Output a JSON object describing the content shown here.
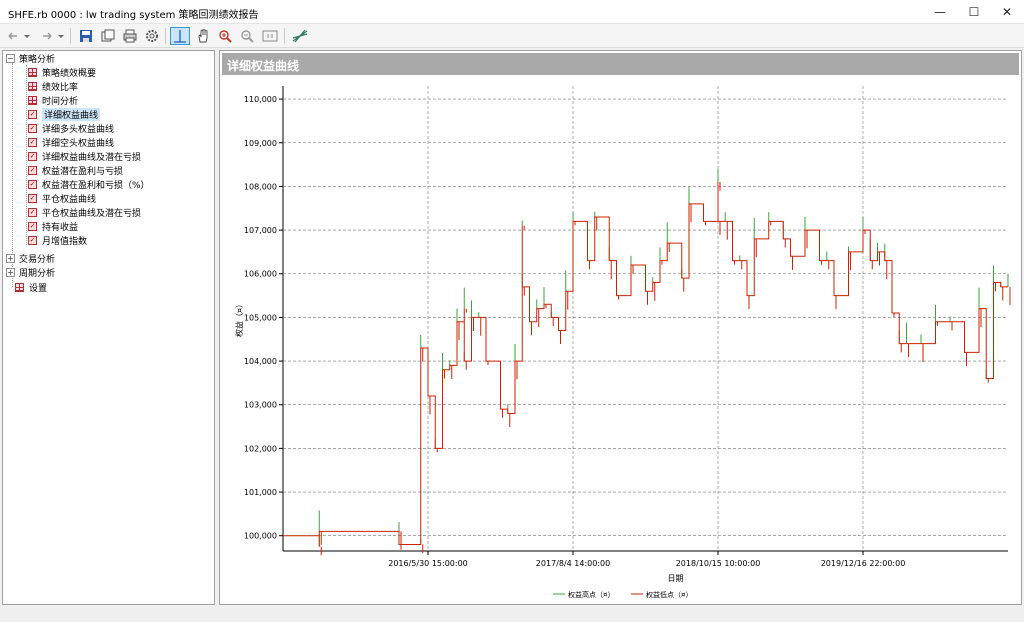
{
  "window": {
    "title": "SHFE.rb 0000 : lw trading system 策略回测绩效报告",
    "minimize": "—",
    "maximize": "☐",
    "close": "✕"
  },
  "toolbar": {
    "icons": [
      "back-icon",
      "dropdown-icon",
      "forward-icon",
      "dropdown-icon",
      "save-icon",
      "open-icon",
      "print-icon",
      "settings-icon",
      "crosshair-icon",
      "pan-hand-icon",
      "zoom-in-icon",
      "zoom-out-icon",
      "fit-icon",
      "chart-icon"
    ]
  },
  "tree": {
    "root": {
      "label": "策略分析",
      "children": [
        "策略绩效概要",
        "绩效比率",
        "时间分析",
        "详细权益曲线",
        "详细多头权益曲线",
        "详细空头权益曲线",
        "详细权益曲线及潜在亏损",
        "权益潜在盈利与亏损",
        "权益潜在盈利和亏损（%）",
        "平仓权益曲线",
        "平仓权益曲线及潜在亏损",
        "持有收益",
        "月增值指数"
      ]
    },
    "others": [
      "交易分析",
      "周期分析"
    ],
    "settings": "设置",
    "selected": "详细权益曲线"
  },
  "panel": {
    "title": "详细权益曲线"
  },
  "chart_data": {
    "type": "line",
    "ylabel": "权益（¤）",
    "xlabel": "日期",
    "ylim": [
      99650,
      110300
    ],
    "y_ticks": [
      "100,000",
      "101,000",
      "102,000",
      "103,000",
      "104,000",
      "105,000",
      "106,000",
      "107,000",
      "108,000",
      "109,000",
      "110,000"
    ],
    "y_tick_values": [
      100000,
      101000,
      102000,
      103000,
      104000,
      105000,
      106000,
      107000,
      108000,
      109000,
      110000
    ],
    "x_ticks": [
      "2016/5/30 15:00:00",
      "2017/8/4 14:00:00",
      "2018/10/15 10:00:00",
      "2019/12/16 22:00:00"
    ],
    "x_tick_index": [
      0.2,
      0.4,
      0.6,
      0.8
    ],
    "grid": true,
    "legend_position": "bottom",
    "series": [
      {
        "name": "权益高点（¤）",
        "color": "#3aa63a"
      },
      {
        "name": "权益低点（¤）",
        "color": "#cc2200"
      }
    ],
    "x": [
      0,
      0.05,
      0.05,
      0.16,
      0.16,
      0.19,
      0.19,
      0.2,
      0.21,
      0.22,
      0.23,
      0.24,
      0.25,
      0.25,
      0.26,
      0.27,
      0.28,
      0.3,
      0.31,
      0.32,
      0.33,
      0.33,
      0.34,
      0.35,
      0.36,
      0.37,
      0.38,
      0.39,
      0.4,
      0.42,
      0.43,
      0.45,
      0.46,
      0.48,
      0.5,
      0.51,
      0.52,
      0.53,
      0.55,
      0.56,
      0.58,
      0.6,
      0.6,
      0.61,
      0.62,
      0.63,
      0.64,
      0.65,
      0.67,
      0.69,
      0.7,
      0.72,
      0.74,
      0.75,
      0.76,
      0.78,
      0.8,
      0.81,
      0.82,
      0.83,
      0.84,
      0.85,
      0.86,
      0.88,
      0.9,
      0.92,
      0.94,
      0.96,
      0.97,
      0.98,
      0.99,
      1.0
    ],
    "values": [
      100000,
      99750,
      100100,
      100100,
      99800,
      99800,
      104300,
      103200,
      102000,
      103800,
      103900,
      104900,
      105200,
      104000,
      105000,
      105000,
      104000,
      102900,
      102800,
      104000,
      107100,
      105700,
      104900,
      105200,
      105300,
      105000,
      104700,
      105600,
      107200,
      106300,
      107300,
      106300,
      105500,
      106200,
      105600,
      105800,
      106300,
      106700,
      105900,
      107600,
      107200,
      108100,
      107200,
      107200,
      106300,
      106300,
      105500,
      106800,
      107200,
      106800,
      106400,
      107000,
      106300,
      106300,
      105500,
      106500,
      107000,
      106300,
      106500,
      106300,
      105100,
      104400,
      104400,
      104400,
      104900,
      104900,
      104200,
      105200,
      103600,
      105800,
      105700,
      105700
    ]
  }
}
